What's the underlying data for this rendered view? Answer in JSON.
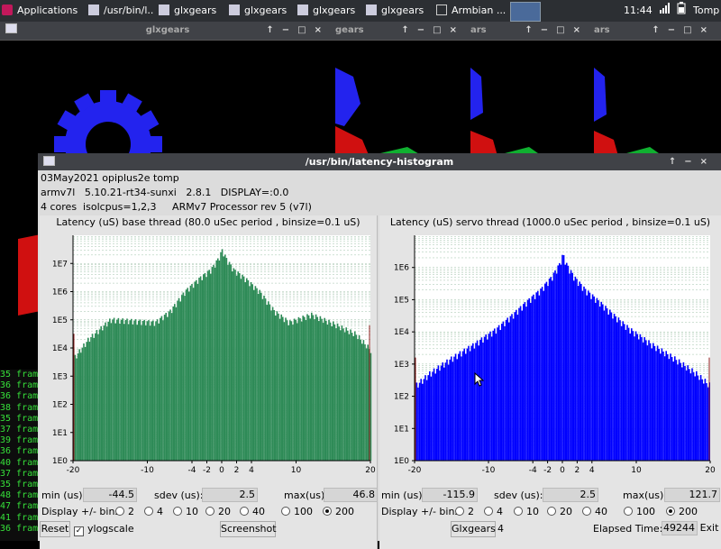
{
  "taskbar": {
    "items": [
      "Applications",
      "/usr/bin/l...",
      "glxgears",
      "glxgears",
      "glxgears",
      "glxgears",
      "Armbian ..."
    ],
    "clock": "11:44",
    "user": "Tomp"
  },
  "gear_windows": [
    {
      "title": "glxgears"
    },
    {
      "title": "gears"
    },
    {
      "title": "ars"
    },
    {
      "title": "ars"
    }
  ],
  "terminal": {
    "lines": [
      "35 fram",
      "36 fram",
      "36 fram",
      "38 fram",
      "35 fram",
      "37 fram",
      "39 fram",
      "36 fram",
      "40 fram",
      "37 fram",
      "35 fram",
      "48 fram",
      "47 fram",
      "41 fram",
      "36 fram"
    ]
  },
  "window": {
    "title": "/usr/bin/latency-histogram",
    "info_line1": "03May2021 opiplus2e tomp",
    "info_line2": "armv7l   5.10.21-rt34-sunxi   2.8.1   DISPLAY=:0.0",
    "info_line3": "4 cores  isolcpus=1,2,3     ARMv7 Processor rev 5 (v7l)"
  },
  "base_panel": {
    "title": "Latency (uS) base thread (80.0 uSec period , binsize=0.1 uS)",
    "min_label": "min (us)",
    "min": "-44.5",
    "sdev_label": "sdev (us):",
    "sdev": "2.5",
    "max_label": "max(us)",
    "max": "46.8",
    "bins_label": "Display +/- bins:",
    "bins": [
      "2",
      "4",
      "10",
      "20",
      "40",
      "100",
      "200"
    ],
    "selected_bins": "200"
  },
  "servo_panel": {
    "title": "Latency (uS) servo thread (1000.0 uSec period , binsize=0.1 uS)",
    "min_label": "min (us)",
    "min": "-115.9",
    "sdev_label": "sdev (us):",
    "sdev": "2.5",
    "max_label": "max(us)",
    "max": "121.7",
    "bins_label": "Display +/- bins:",
    "bins": [
      "2",
      "4",
      "10",
      "20",
      "40",
      "100",
      "200"
    ],
    "selected_bins": "200"
  },
  "bottom": {
    "reset": "Reset",
    "ylogscale": "ylogscale",
    "screenshot": "Screenshot",
    "glxgears_label": "Glxgears",
    "glxgears_count": "4",
    "elapsed_label": "Elapsed Time:",
    "elapsed": "49244",
    "exit": "Exit"
  },
  "colors": {
    "base_fill": "#2e8b57",
    "servo_fill": "#0000ff",
    "spike": "#8b1a1a"
  },
  "chart_data": [
    {
      "type": "bar",
      "title": "Latency (uS) base thread (80.0 uSec period , binsize=0.1 uS)",
      "y_scale": "log",
      "yticks": [
        "1E0",
        "1E1",
        "1E2",
        "1E3",
        "1E4",
        "1E5",
        "1E6",
        "1E7"
      ],
      "xticks": [
        "-20",
        "-10",
        "-4",
        "-2",
        "0",
        "2",
        "4",
        "10",
        "20"
      ],
      "x": [
        -20,
        -18,
        -15,
        -12,
        -9,
        -7,
        -5,
        -3,
        -1.5,
        -0.5,
        0,
        0.5,
        1.5,
        3,
        5,
        7,
        9,
        12,
        15,
        18,
        20
      ],
      "y": [
        4000,
        20000,
        100000,
        90000,
        80000,
        200000,
        1000000,
        3000000,
        6000000,
        15000000,
        30000000,
        15000000,
        6000000,
        3000000,
        1000000,
        200000,
        80000,
        150000,
        70000,
        30000,
        8000
      ],
      "xlim": [
        -20,
        20
      ],
      "ylim": [
        1,
        100000000.0
      ]
    },
    {
      "type": "bar",
      "title": "Latency (uS) servo thread (1000.0 uSec period , binsize=0.1 uS)",
      "y_scale": "log",
      "yticks": [
        "1E0",
        "1E1",
        "1E2",
        "1E3",
        "1E4",
        "1E5",
        "1E6"
      ],
      "xticks": [
        "-20",
        "-10",
        "-4",
        "-2",
        "0",
        "2",
        "4",
        "10",
        "20"
      ],
      "x": [
        -20,
        -18,
        -15,
        -12,
        -9,
        -7,
        -5,
        -3,
        -1.5,
        -0.5,
        0,
        0.5,
        1.5,
        3,
        5,
        7,
        9,
        12,
        15,
        18,
        20
      ],
      "y": [
        200,
        500,
        1500,
        4000,
        12000,
        30000,
        80000,
        200000,
        500000,
        1200000,
        2500000,
        1200000,
        500000,
        200000,
        80000,
        30000,
        12000,
        4000,
        1500,
        500,
        200
      ],
      "xlim": [
        -20,
        20
      ],
      "ylim": [
        1,
        10000000.0
      ]
    }
  ]
}
